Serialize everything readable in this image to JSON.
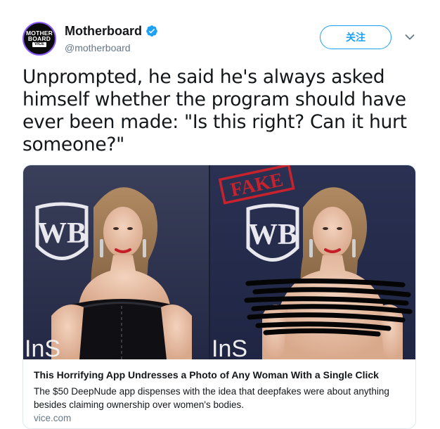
{
  "account": {
    "avatar_lines": [
      "MOTHER",
      "BOARD",
      "VICE"
    ],
    "name": "Motherboard",
    "handle": "@motherboard",
    "verified": true
  },
  "actions": {
    "follow_label": "关注",
    "more_icon": "chevron-down-icon"
  },
  "tweet": {
    "text": "Unprompted, he said he's always asked himself whether the program should have ever been made: \"Is this right? Can it hurt someone?\""
  },
  "card": {
    "image": {
      "left_logo": "WB",
      "right_logo": "WB",
      "stamp_text": "FAKE",
      "bottom_left_text": "InS",
      "bottom_right_text": "InS"
    },
    "title": "This Horrifying App Undresses a Photo of Any Woman With a Single Click",
    "description": "The $50 DeepNude app dispenses with the idea that deepfakes were about anything besides claiming ownership over women's bodies.",
    "domain": "vice.com"
  },
  "colors": {
    "accent": "#1da1f2",
    "text": "#14171a",
    "muted": "#657786",
    "stamp": "#c8232c",
    "backdrop": "#2b3350"
  }
}
